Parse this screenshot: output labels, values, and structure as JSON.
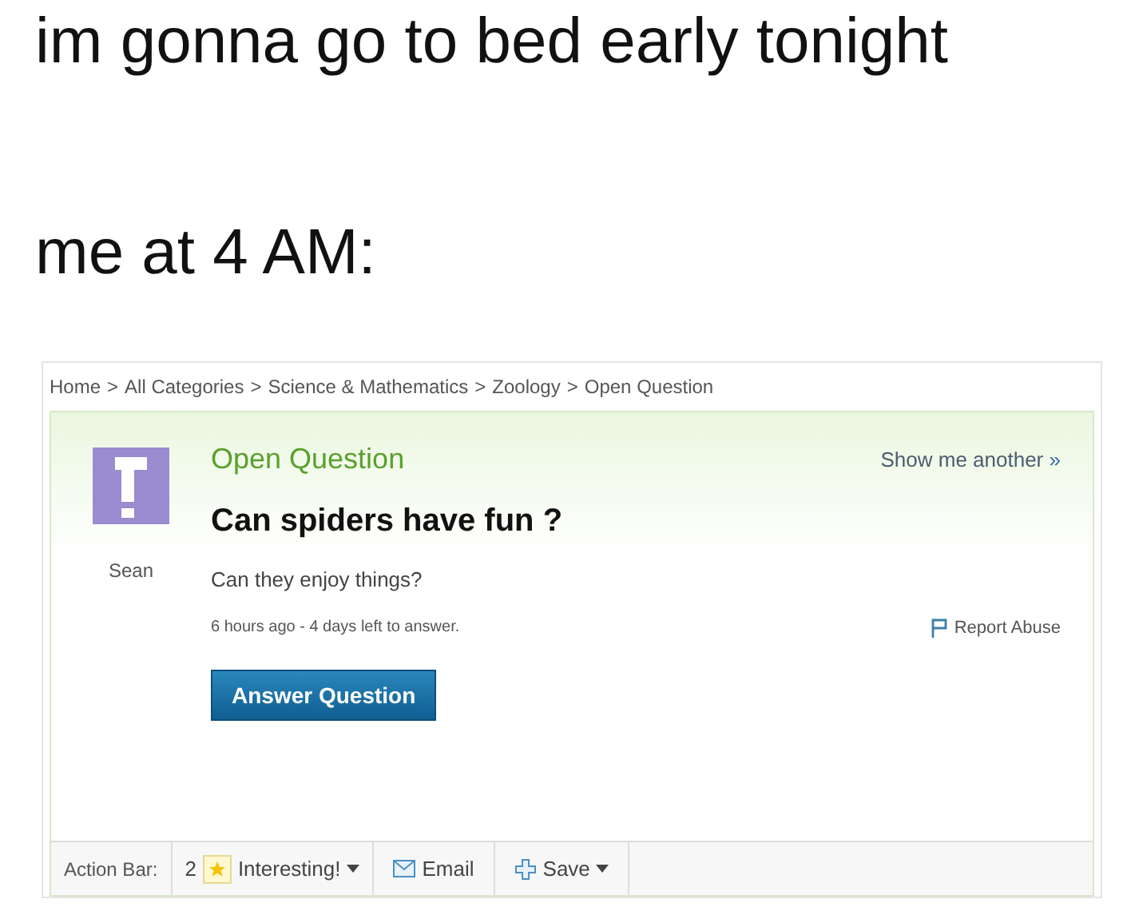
{
  "caption": {
    "line_1": "im gonna go to bed early tonight",
    "line_2": "me at 4 AM:"
  },
  "breadcrumb": {
    "separator": ">",
    "items": [
      "Home",
      "All Categories",
      "Science & Mathematics",
      "Zoology",
      "Open Question"
    ]
  },
  "asker": {
    "name": "Sean"
  },
  "question": {
    "status": "Open Question",
    "show_another": "Show me another",
    "show_another_arrow": "»",
    "title": "Can spiders have fun ?",
    "body": "Can they enjoy things?",
    "meta": "6 hours ago - 4 days left to answer.",
    "report": "Report Abuse",
    "answer_button": "Answer Question"
  },
  "action_bar": {
    "label": "Action Bar:",
    "items": [
      {
        "kind": "interesting",
        "count": "2",
        "label": "Interesting!"
      },
      {
        "kind": "email",
        "label": "Email"
      },
      {
        "kind": "save",
        "label": "Save"
      }
    ]
  }
}
